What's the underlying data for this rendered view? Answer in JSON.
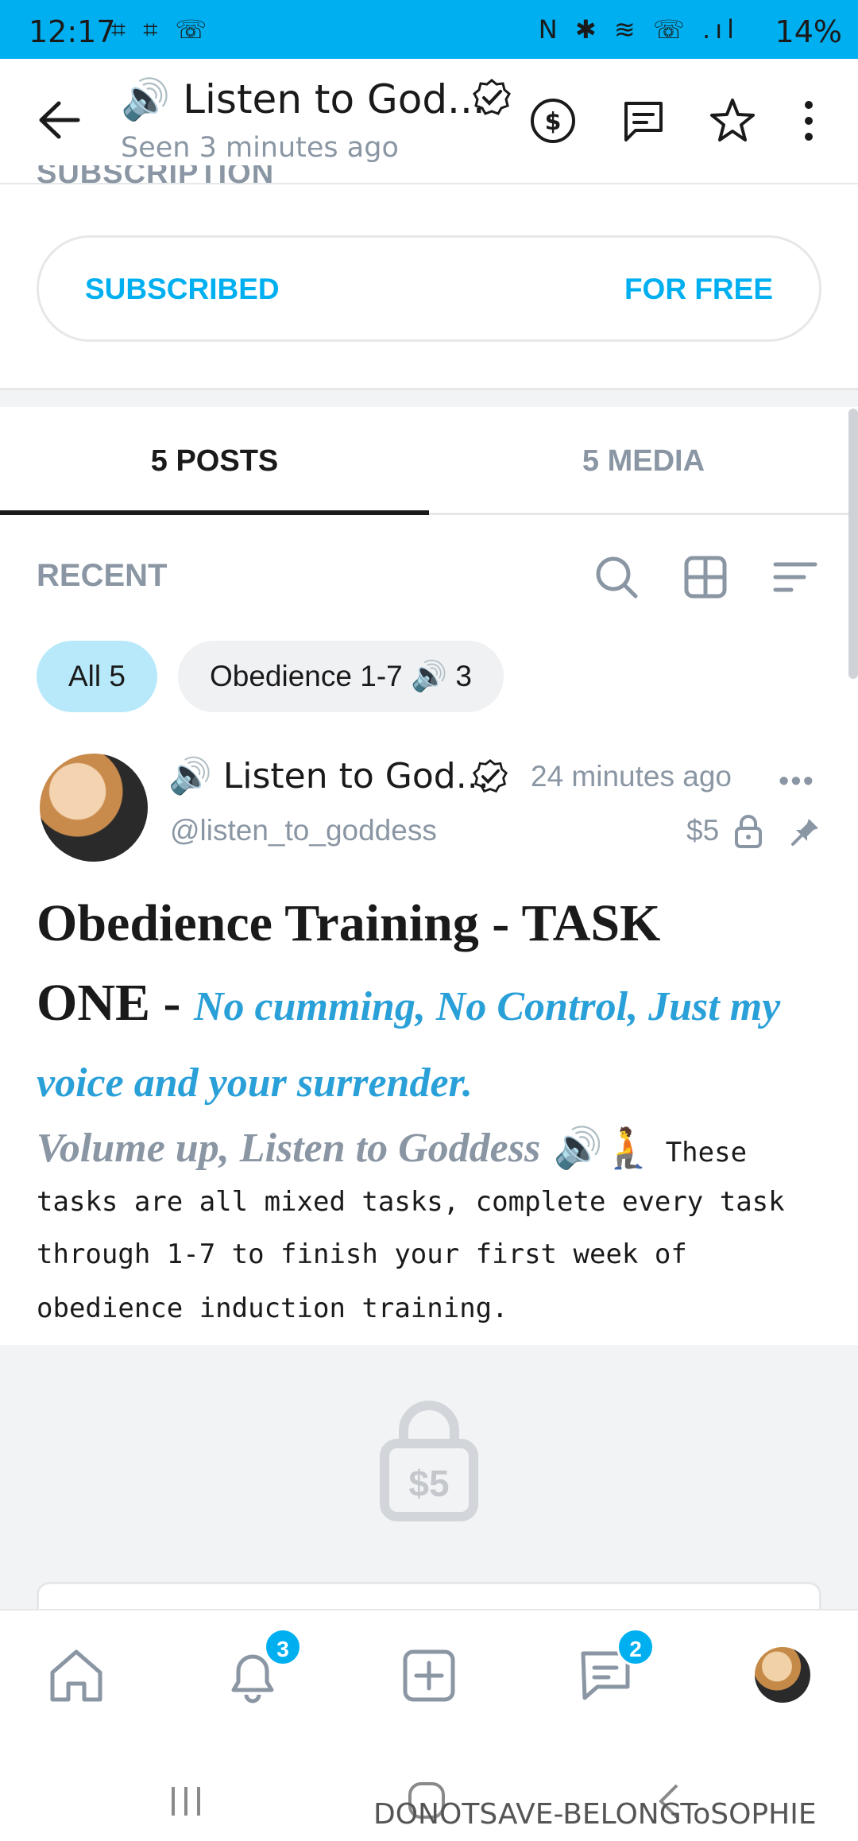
{
  "status_bar": {
    "time": "12:17",
    "left_icons": "⌗ ⌗ ☏",
    "right_icons": "N ✱ ≋ ☏ .ıl",
    "battery": "14%"
  },
  "header": {
    "title": "🔊 Listen to God...",
    "subtitle": "Seen  3 minutes ago",
    "icons": [
      "back-arrow-icon",
      "verified-icon",
      "dollar-icon",
      "message-icon",
      "star-icon",
      "kebab-icon"
    ]
  },
  "subscription": {
    "label": "SUBSCRIPTION",
    "status": "SUBSCRIBED",
    "price": "FOR FREE"
  },
  "tabs": [
    {
      "label": "5 POSTS",
      "active": true
    },
    {
      "label": "5 MEDIA",
      "active": false
    }
  ],
  "filters": {
    "title": "RECENT",
    "chips": [
      {
        "label": "All 5",
        "active": true
      },
      {
        "label": "Obedience 1-7 🔊 3",
        "active": false
      }
    ]
  },
  "post": {
    "author": "🔊 Listen to God...",
    "time": "24 minutes ago",
    "handle": "@listen_to_goddess",
    "price": "$5",
    "title_line1": "Obedience Training - TASK",
    "title_line2_prefix": "ONE -",
    "title_line2_italic": "No cumming, No Control, Just my",
    "title_line3_italic": "voice and your surrender.",
    "line4_italic": "Volume up, Listen to Goddess",
    "line4_emoji": "🔊🧎",
    "line4_text": "These",
    "body_lines": [
      "tasks are all mixed tasks, complete every task",
      "through 1-7 to finish your first week of",
      "obedience induction training."
    ],
    "locked_price": "$5"
  },
  "bottom_nav": {
    "notifications_badge": "3",
    "messages_badge": "2"
  },
  "watermark": "DONOTSAVE-BELONGToSOPHIE",
  "colors": {
    "accent": "#00aff0",
    "muted": "#8a96a3",
    "text": "#1a1a1a",
    "italic_blue": "#2aa0d8"
  }
}
